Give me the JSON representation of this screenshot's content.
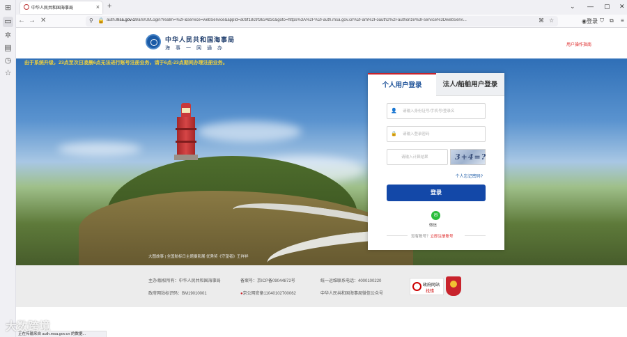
{
  "browser": {
    "tab_title": "中华人民共和国海事局",
    "new_tab": "+",
    "url_prefix": "auth.",
    "url_domain": "msa.gov.cn",
    "url_rest": "/am/UI/Login?realm=%2F&service=webService&appId=a09f18c9f3634d3c&goto=https%3A%2F%2Fauth.msa.gov.cn%2Fam%2Foauth2%2Fauthorize%3Fservice%3DwebServi...",
    "status_text": "正在传输来自 auth.msa.gov.cn 的数据..."
  },
  "header": {
    "title": "中华人民共和国海事局",
    "subtitle": "海事一网通办",
    "guide_link": "用户操作指南"
  },
  "banner": {
    "notice": "由于系统升级，23点至次日凌晨6点无法进行账号注册业务，请于6点-23点期间办理注册业务。",
    "caption": "大图故事 | 全国航标日主题摄影展 优秀奖《守望者》王祥祥"
  },
  "login": {
    "tab_personal": "个人用户登录",
    "tab_corporate": "法人/船舶用户登录",
    "username_placeholder": "请输入身份证号/手机号/登录名",
    "password_placeholder": "请输入登录密码",
    "captcha_placeholder": "请输入计算结果",
    "captcha_text": "3+4=?",
    "forgot_link": "个人忘记密码?",
    "login_button": "登录",
    "wechat_label": "微信",
    "no_account": "没有账号？",
    "register_link": "立即注册账号"
  },
  "footer": {
    "sponsor": "主办/版权所有：中华人民共和国海事局",
    "icp": "备案号：京ICP备09044872号",
    "hotline": "统一运维联系电话：4000100220",
    "gov_code": "政府网站标识码：BM19010001",
    "police": "京公网安备11040102700062",
    "wechat_account": "中华人民共和国海事局微信公众号",
    "badge_line1": "政府网站",
    "badge_line2": "找错"
  },
  "watermark": "大数跨境",
  "icons": {
    "lock": "lock-icon",
    "user": "user-icon",
    "wechat": "wechat-icon"
  }
}
